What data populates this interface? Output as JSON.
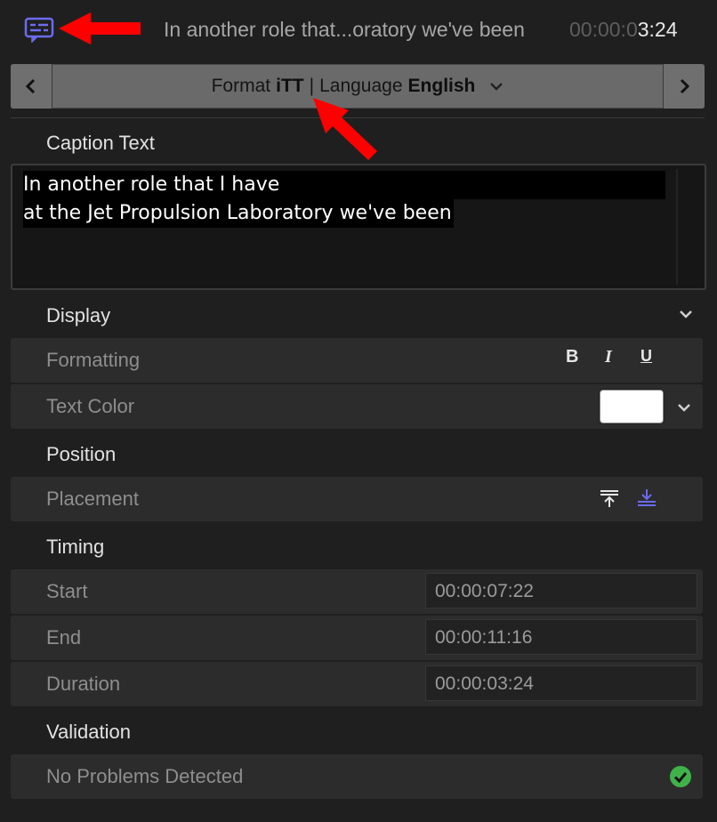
{
  "header": {
    "caption_title": "In another role that...oratory we've been",
    "timecode_dim": "00:00:0",
    "timecode_lit": "3:24"
  },
  "format_bar": {
    "format_label": "Format",
    "format_value": "iTT",
    "separator": "|",
    "language_label": "Language",
    "language_value": "English"
  },
  "caption_text": {
    "heading": "Caption Text",
    "lines": [
      "In another role that I have",
      "at the Jet Propulsion Laboratory we've been"
    ]
  },
  "display": {
    "heading": "Display",
    "formatting_label": "Formatting",
    "bold": "B",
    "italic": "I",
    "underline": "U",
    "text_color_label": "Text Color",
    "text_color_value": "#ffffff"
  },
  "position": {
    "heading": "Position",
    "placement_label": "Placement"
  },
  "timing": {
    "heading": "Timing",
    "start_label": "Start",
    "start_value": "00:00:07:22",
    "end_label": "End",
    "end_value": "00:00:11:16",
    "duration_label": "Duration",
    "duration_value": "00:00:03:24"
  },
  "validation": {
    "heading": "Validation",
    "status_label": "No Problems Detected",
    "status_color": "#3fb24a"
  },
  "colors": {
    "accent": "#6b6bf0",
    "annotation_arrow": "#ff0000"
  }
}
